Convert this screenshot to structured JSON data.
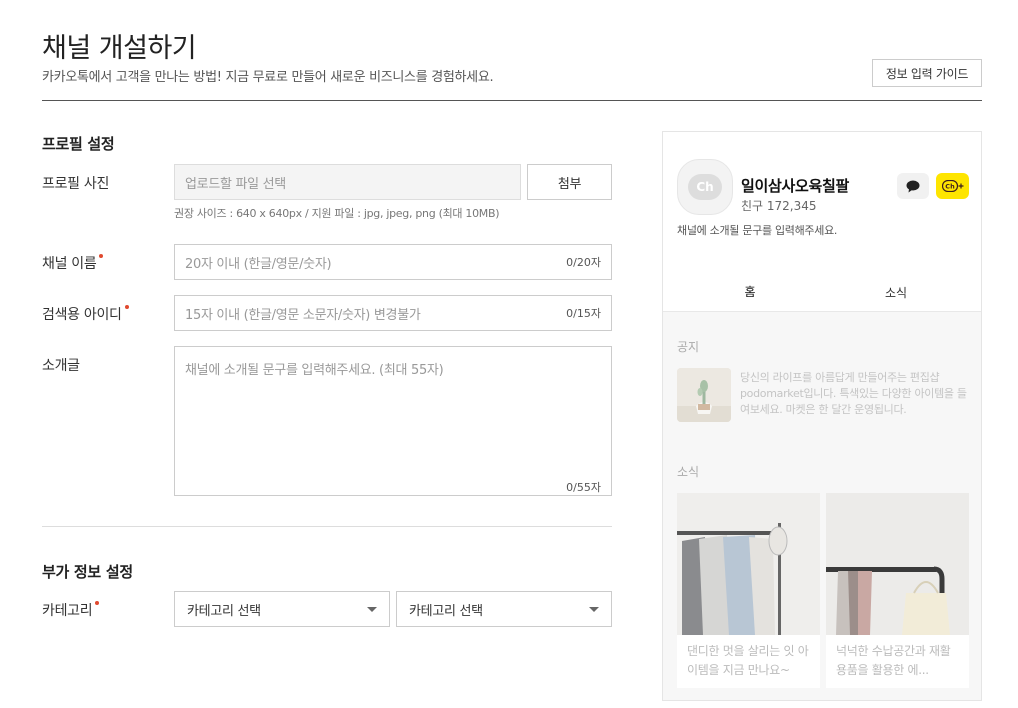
{
  "header": {
    "title": "채널 개설하기",
    "subtitle": "카카오톡에서 고객을 만나는 방법! 지금 무료로 만들어 새로운 비즈니스를 경험하세요.",
    "guide_button": "정보 입력 가이드"
  },
  "profile_section": {
    "title": "프로필 설정",
    "photo": {
      "label": "프로필 사진",
      "placeholder": "업로드할 파일 선택",
      "attach_button": "첨부",
      "hint": "권장 사이즈 : 640 x 640px / 지원 파일 : jpg, jpeg, png (최대 10MB)"
    },
    "channel_name": {
      "label": "채널 이름",
      "placeholder": "20자 이내 (한글/영문/숫자)",
      "counter": "0/20자"
    },
    "search_id": {
      "label": "검색용 아이디",
      "placeholder": "15자 이내 (한글/영문 소문자/숫자) 변경불가",
      "counter": "0/15자"
    },
    "intro": {
      "label": "소개글",
      "placeholder": "채널에 소개될 문구를 입력해주세요. (최대 55자)",
      "counter": "0/55자"
    }
  },
  "extra_section": {
    "title": "부가 정보 설정",
    "category": {
      "label": "카테고리",
      "select_1": "카테고리 선택",
      "select_2": "카테고리 선택"
    }
  },
  "preview": {
    "avatar_text": "Ch",
    "channel_name": "일이삼사오육칠팔",
    "friends": "친구 172,345",
    "description": "채널에 소개될 문구를 입력해주세요.",
    "tabs": [
      "홈",
      "소식"
    ],
    "notice_label": "공지",
    "notice_text": "당신의 라이프를 아름답게 만들어주는 편집샵 podomarket입니다. 특색있는 다양한 아이템을 들여보세요. 마켓은 한 달간 운영됩니다.",
    "news_label": "소식",
    "cards": [
      {
        "text": "댄디한 멋을 살리는 잇 아이템을 지금 만나요~"
      },
      {
        "text": "넉넉한 수납공간과 재활용품을 활용한 에..."
      }
    ],
    "icons": {
      "chat": "speech-bubble-icon",
      "add": "channel-add-icon"
    },
    "colors": {
      "add_button": "#fee500",
      "required_dot": "#e0492f"
    }
  }
}
